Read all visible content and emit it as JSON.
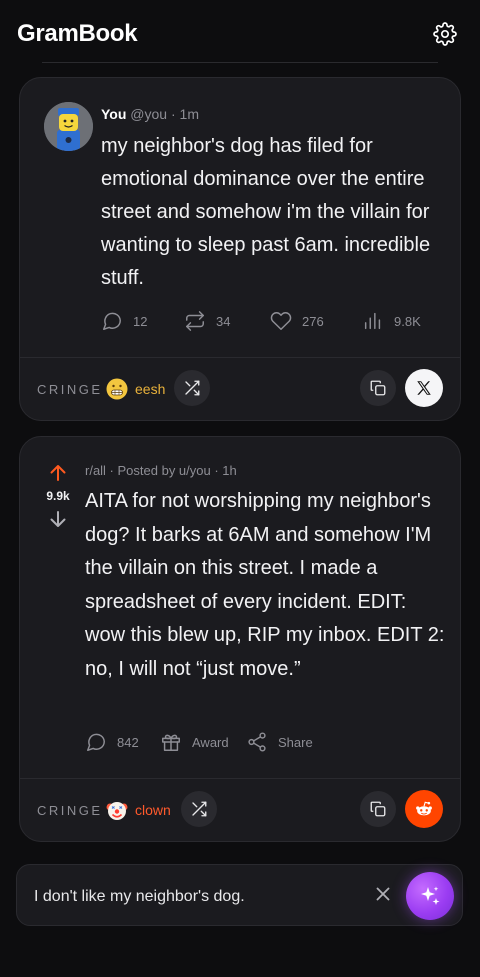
{
  "app": {
    "title": "GramBook"
  },
  "header": {
    "settings_icon": "gear-icon"
  },
  "tweet_card": {
    "author_name": "You",
    "author_handle": "@you",
    "time": "· 1m",
    "text": "my neighbor's dog has filed for emotional dominance over the entire street and somehow i'm the villain for wanting to sleep past 6am. incredible stuff.",
    "replies": "12",
    "retweets": "34",
    "likes": "276",
    "views": "9.8K",
    "cringe_label": "CRINGE",
    "cringe_emoji": "grimacing-face",
    "cringe_tag": "eesh",
    "cringe_color": "#e8b13b",
    "platform_icon": "x-logo-icon"
  },
  "reddit_card": {
    "meta": "r/all · Posted by u/you · 1h",
    "votes": "9.9k",
    "text": "AITA for not worshipping my neighbor's dog? It barks at 6AM and somehow I'M the villain on this street. I made a spreadsheet of every incident. EDIT: wow this blew up, RIP my inbox. EDIT 2: no, I will not “just move.”",
    "comments": "842",
    "award_label": "Award",
    "share_label": "Share",
    "cringe_label": "CRINGE",
    "cringe_emoji": "clown-face",
    "cringe_tag": "clown",
    "cringe_color": "#ff5a2c",
    "upvote_color": "#ff5a1f",
    "platform_icon": "reddit-logo-icon",
    "platform_color": "#ff4500"
  },
  "composer": {
    "value": "I don't like my neighbor's dog.",
    "action_icon": "sparkles-icon"
  }
}
